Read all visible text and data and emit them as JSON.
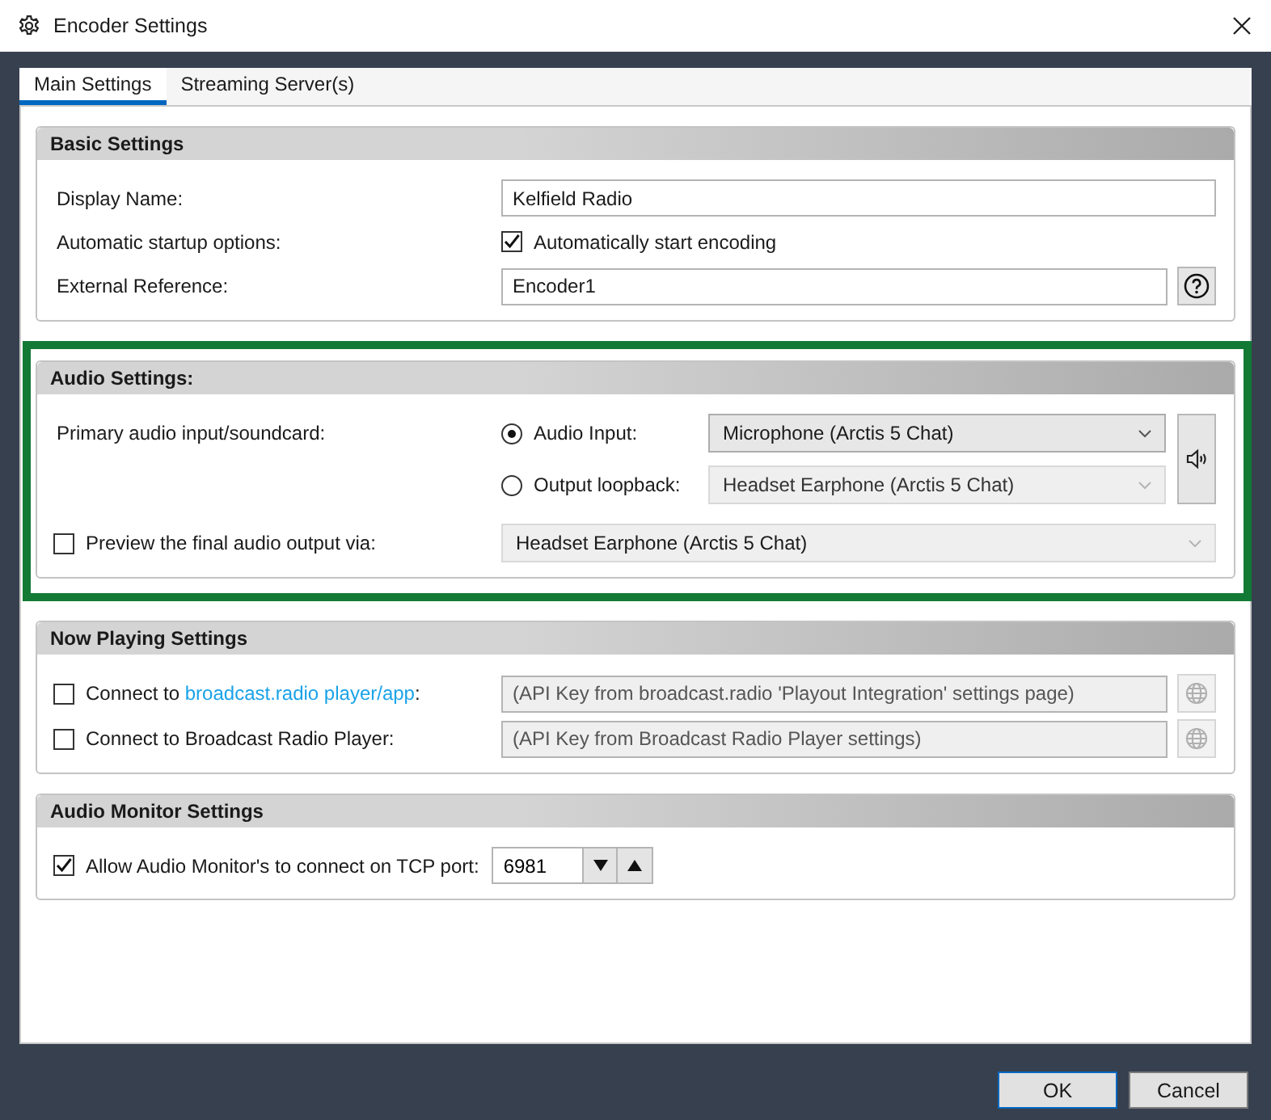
{
  "window": {
    "title": "Encoder Settings"
  },
  "tabs": [
    {
      "label": "Main Settings",
      "selected": true
    },
    {
      "label": "Streaming Server(s)",
      "selected": false
    }
  ],
  "sections": [
    {
      "title": "Basic Settings",
      "highlighted": false,
      "rows": [
        {
          "kind": "text",
          "label": "Display Name:",
          "value": "Kelfield Radio"
        },
        {
          "kind": "toggle",
          "label": "Automatic startup options:",
          "option": "Automatically start encoding",
          "checked": true
        },
        {
          "kind": "text",
          "label": "External Reference:",
          "value": "Encoder1",
          "button": {
            "kind": "help"
          }
        }
      ]
    },
    {
      "title": "Audio Settings:",
      "highlighted": true,
      "rows": [
        {
          "kind": "source",
          "label": "Primary audio input/soundcard:",
          "button": {
            "kind": "speaker"
          },
          "options": [
            {
              "label": "Audio Input:",
              "selected": true,
              "device": "Microphone (Arctis 5 Chat)",
              "disabled": false
            },
            {
              "label": "Output loopback:",
              "selected": false,
              "device": "Headset Earphone (Arctis 5 Chat)",
              "disabled": true
            }
          ]
        },
        {
          "kind": "checked_dropdown",
          "label": "Preview the final audio output via:",
          "checked": false,
          "device": "Headset Earphone (Arctis 5 Chat)",
          "disabled": true
        }
      ]
    },
    {
      "title": "Now Playing Settings",
      "highlighted": false,
      "rows": [
        {
          "kind": "checked_field",
          "label": "Connect to ",
          "link": "broadcast.radio player/app",
          "label_end": ":",
          "checked": false,
          "placeholder": "(API Key from broadcast.radio 'Playout Integration' settings page)",
          "disabled": true,
          "button": {
            "kind": "web"
          }
        },
        {
          "kind": "checked_field",
          "label": "Connect to Broadcast Radio Player:",
          "checked": false,
          "placeholder": "(API Key from Broadcast Radio Player settings)",
          "disabled": true,
          "button": {
            "kind": "web"
          }
        }
      ]
    },
    {
      "title": "Audio Monitor Settings",
      "highlighted": false,
      "rows": [
        {
          "kind": "port",
          "label": "Allow Audio Monitor's to connect on TCP port:",
          "checked": true,
          "value": "6981"
        }
      ]
    }
  ],
  "buttons": [
    {
      "label": "OK",
      "default": true
    },
    {
      "label": "Cancel",
      "default": false
    }
  ]
}
